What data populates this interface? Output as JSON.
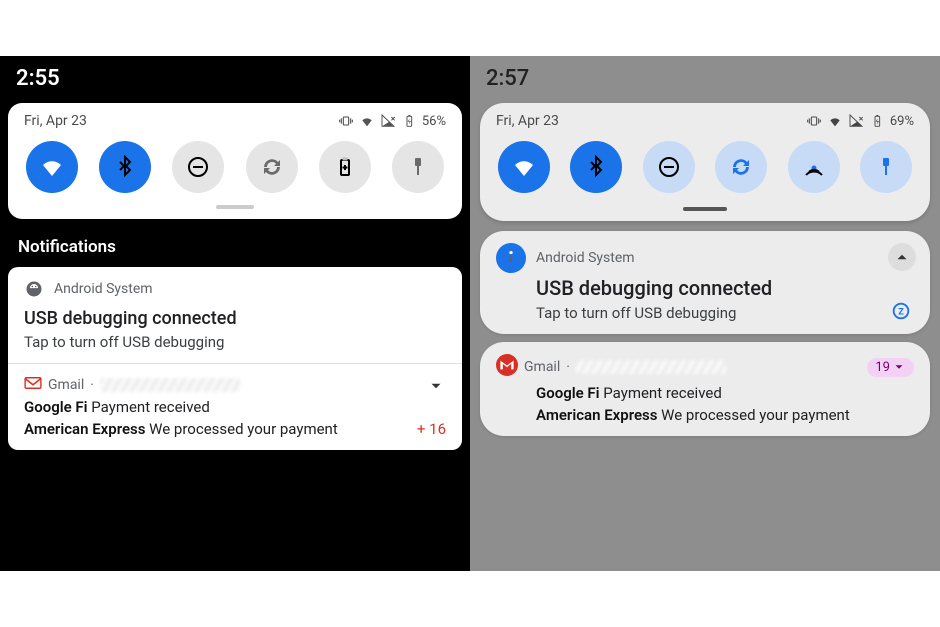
{
  "left": {
    "time": "2:55",
    "date": "Fri, Apr 23",
    "battery": "56%",
    "toggles": [
      {
        "name": "wifi",
        "on": true
      },
      {
        "name": "bluetooth",
        "on": true
      },
      {
        "name": "dnd",
        "on": false
      },
      {
        "name": "autorotate",
        "on": false
      },
      {
        "name": "battery",
        "on": false
      },
      {
        "name": "flashlight",
        "on": false
      }
    ],
    "section_header": "Notifications",
    "notif_system": {
      "app": "Android System",
      "title": "USB debugging connected",
      "sub": "Tap to turn off USB debugging"
    },
    "notif_gmail": {
      "app": "Gmail",
      "line1_bold": "Google Fi",
      "line1_rest": " Payment received",
      "line2_bold": "American Express",
      "line2_rest": " We processed your payment",
      "extra_count": "+ 16"
    }
  },
  "right": {
    "time": "2:57",
    "date": "Fri, Apr 23",
    "battery": "69%",
    "toggles": [
      {
        "name": "wifi",
        "on": true
      },
      {
        "name": "bluetooth",
        "on": true
      },
      {
        "name": "dnd",
        "on": false
      },
      {
        "name": "autorotate",
        "on": false
      },
      {
        "name": "hotspot",
        "on": false
      },
      {
        "name": "flashlight",
        "on": false
      }
    ],
    "notif_system": {
      "app": "Android System",
      "title": "USB debugging connected",
      "sub": "Tap to turn off USB debugging"
    },
    "notif_gmail": {
      "app": "Gmail",
      "line1_bold": "Google Fi",
      "line1_rest": " Payment received",
      "line2_bold": "American Express",
      "line2_rest": " We processed your payment",
      "badge": "19"
    }
  }
}
